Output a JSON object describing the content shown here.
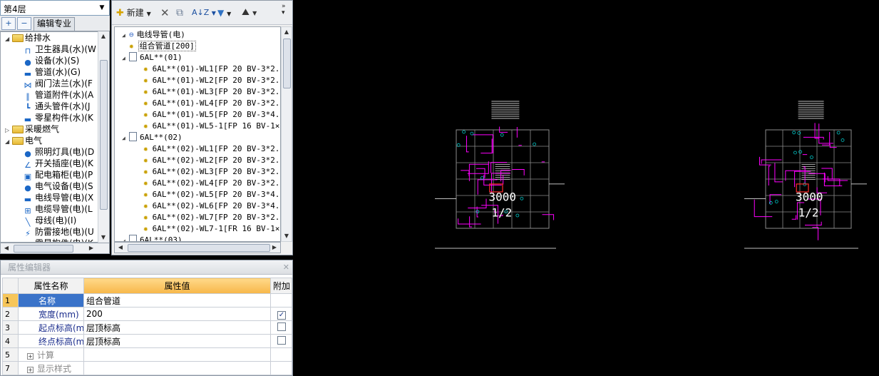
{
  "floor_select": {
    "value": "第4层"
  },
  "left_toolbar": {
    "expand_label": "+",
    "collapse_label": "−",
    "edit_specialty_label": "编辑专业"
  },
  "left_tree": [
    {
      "label": "给排水",
      "level": 0,
      "kind": "folder",
      "expanded": true
    },
    {
      "label": "卫生器具(水)(W",
      "level": 1,
      "icon": "sanitary-fixture-icon",
      "glyph": "⊓"
    },
    {
      "label": "设备(水)(S)",
      "level": 1,
      "icon": "pump-icon",
      "glyph": "●"
    },
    {
      "label": "管道(水)(G)",
      "level": 1,
      "icon": "pipe-icon",
      "glyph": "▬"
    },
    {
      "label": "阀门法兰(水)(F",
      "level": 1,
      "icon": "valve-icon",
      "glyph": "⋈"
    },
    {
      "label": "管道附件(水)(A",
      "level": 1,
      "icon": "pipe-accessory-icon",
      "glyph": "∥"
    },
    {
      "label": "通头管件(水)(J",
      "level": 1,
      "icon": "fitting-icon",
      "glyph": "┗"
    },
    {
      "label": "零星构件(水)(K",
      "level": 1,
      "icon": "misc-component-icon",
      "glyph": "▬"
    },
    {
      "label": "采暖燃气",
      "level": 0,
      "kind": "folder",
      "expanded": false
    },
    {
      "label": "电气",
      "level": 0,
      "kind": "folder",
      "expanded": true
    },
    {
      "label": "照明灯具(电)(D",
      "level": 1,
      "icon": "bulb-icon",
      "glyph": "●"
    },
    {
      "label": "开关插座(电)(K",
      "level": 1,
      "icon": "switch-icon",
      "glyph": "∠"
    },
    {
      "label": "配电箱柜(电)(P",
      "level": 1,
      "icon": "panel-box-icon",
      "glyph": "▣"
    },
    {
      "label": "电气设备(电)(S",
      "level": 1,
      "icon": "electrical-device-icon",
      "glyph": "●"
    },
    {
      "label": "电线导管(电)(X",
      "level": 1,
      "icon": "conduit-icon",
      "glyph": "▬"
    },
    {
      "label": "电缆导管(电)(L",
      "level": 1,
      "icon": "cable-conduit-icon",
      "glyph": "⊞"
    },
    {
      "label": "母线(电)(I)",
      "level": 1,
      "icon": "busbar-icon",
      "glyph": "╲"
    },
    {
      "label": "防雷接地(电)(U",
      "level": 1,
      "icon": "lightning-icon",
      "glyph": "⚡"
    },
    {
      "label": "零星构件(电)(K",
      "level": 1,
      "icon": "misc-component-icon",
      "glyph": "▬"
    }
  ],
  "mid_toolbar": {
    "new_label": "新建",
    "sort_label": "A↓Z",
    "filter_label": "▼",
    "find_label": "⛰"
  },
  "mid_tree": [
    {
      "label": "电线导管(电)",
      "level": 0,
      "kind": "root"
    },
    {
      "label": "组合管道[200]",
      "level": 1,
      "kind": "gear",
      "selected": true
    },
    {
      "label": "6AL**(01)",
      "level": 1,
      "kind": "doc"
    },
    {
      "label": "6AL**(01)-WL1[FP 20 BV-3*2.",
      "level": 2,
      "kind": "gear"
    },
    {
      "label": "6AL**(01)-WL2[FP 20 BV-3*2.",
      "level": 2,
      "kind": "gear"
    },
    {
      "label": "6AL**(01)-WL3[FP 20 BV-3*2.",
      "level": 2,
      "kind": "gear"
    },
    {
      "label": "6AL**(01)-WL4[FP 20 BV-3*2.",
      "level": 2,
      "kind": "gear"
    },
    {
      "label": "6AL**(01)-WL5[FP 20 BV-3*4.",
      "level": 2,
      "kind": "gear"
    },
    {
      "label": "6AL**(01)-WL5-1[FP 16 BV-1×",
      "level": 2,
      "kind": "gear"
    },
    {
      "label": "6AL**(02)",
      "level": 1,
      "kind": "doc"
    },
    {
      "label": "6AL**(02)-WL1[FP 20 BV-3*2.",
      "level": 2,
      "kind": "gear"
    },
    {
      "label": "6AL**(02)-WL2[FP 20 BV-3*2.",
      "level": 2,
      "kind": "gear"
    },
    {
      "label": "6AL**(02)-WL3[FP 20 BV-3*2.",
      "level": 2,
      "kind": "gear"
    },
    {
      "label": "6AL**(02)-WL4[FP 20 BV-3*2.",
      "level": 2,
      "kind": "gear"
    },
    {
      "label": "6AL**(02)-WL5[FP 20 BV-3*4.",
      "level": 2,
      "kind": "gear"
    },
    {
      "label": "6AL**(02)-WL6[FP 20 BV-3*4.",
      "level": 2,
      "kind": "gear"
    },
    {
      "label": "6AL**(02)-WL7[FP 20 BV-3*2.",
      "level": 2,
      "kind": "gear"
    },
    {
      "label": "6AL**(02)-WL7-1[FR 16 BV-1×",
      "level": 2,
      "kind": "gear"
    },
    {
      "label": "6AL**(03)",
      "level": 1,
      "kind": "doc"
    }
  ],
  "property_editor": {
    "title": "属性编辑器",
    "headers": {
      "name": "属性名称",
      "value": "属性值",
      "extra": "附加"
    },
    "rows": [
      {
        "num": "1",
        "name": "名称",
        "value": "组合管道",
        "checkbox": null,
        "selected": true
      },
      {
        "num": "2",
        "name": "宽度(mm)",
        "value": "200",
        "checkbox": true
      },
      {
        "num": "3",
        "name": "起点标高(m)",
        "value": "层顶标高",
        "checkbox": false
      },
      {
        "num": "4",
        "name": "终点标高(m)",
        "value": "层顶标高",
        "checkbox": false
      },
      {
        "num": "5",
        "name": "计算",
        "value": "",
        "group": true
      },
      {
        "num": "7",
        "name": "显示样式",
        "value": "",
        "group": true
      }
    ]
  },
  "canvas": {
    "plans": [
      {
        "label_main": "3000",
        "label_sub": "1/2"
      },
      {
        "label_main": "3000",
        "label_sub": "1/2"
      }
    ],
    "colors": {
      "magenta": "#ff00ff",
      "gray": "#8c8c8c",
      "white": "#ffffff",
      "red": "#ff2a2a",
      "cyan": "#00c8c8"
    }
  }
}
